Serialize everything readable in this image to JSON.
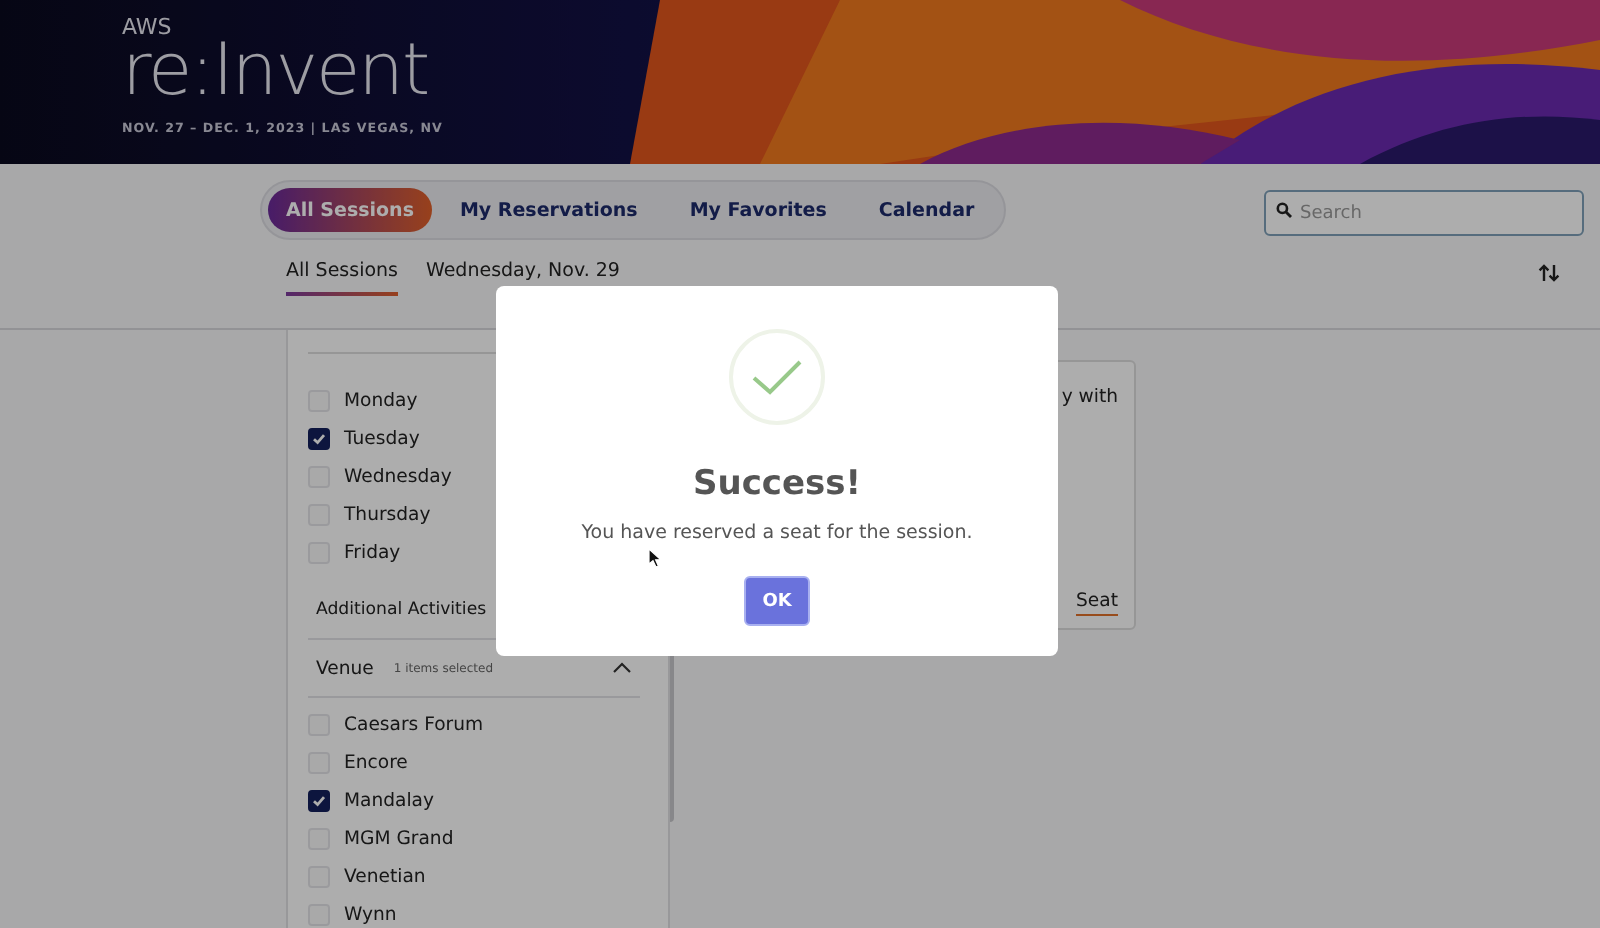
{
  "banner": {
    "brand": "AWS",
    "event": "re:Invent",
    "dates": "NOV. 27 – DEC. 1, 2023 | LAS VEGAS, NV"
  },
  "nav_tabs": [
    {
      "label": "All Sessions",
      "selected": true
    },
    {
      "label": "My Reservations",
      "selected": false
    },
    {
      "label": "My Favorites",
      "selected": false
    },
    {
      "label": "Calendar",
      "selected": false
    }
  ],
  "search": {
    "placeholder": "Search"
  },
  "sub_tabs": [
    {
      "label": "All Sessions",
      "selected": true
    },
    {
      "label": "Wednesday, Nov. 29",
      "selected": false
    }
  ],
  "filters": {
    "days": [
      {
        "label": "Monday",
        "checked": false
      },
      {
        "label": "Tuesday",
        "checked": true
      },
      {
        "label": "Wednesday",
        "checked": false
      },
      {
        "label": "Thursday",
        "checked": false
      },
      {
        "label": "Friday",
        "checked": false
      }
    ],
    "additional": "Additional Activities",
    "venue": {
      "title": "Venue",
      "summary": "1 items selected",
      "expanded": true,
      "options": [
        {
          "label": "Caesars Forum",
          "checked": false
        },
        {
          "label": "Encore",
          "checked": false
        },
        {
          "label": "Mandalay",
          "checked": true
        },
        {
          "label": "MGM Grand",
          "checked": false
        },
        {
          "label": "Venetian",
          "checked": false
        },
        {
          "label": "Wynn",
          "checked": false
        }
      ]
    }
  },
  "session_card": {
    "fragment": "y with",
    "action": "Seat"
  },
  "modal": {
    "title": "Success!",
    "message": "You have reserved a seat for the session.",
    "button": "OK"
  }
}
